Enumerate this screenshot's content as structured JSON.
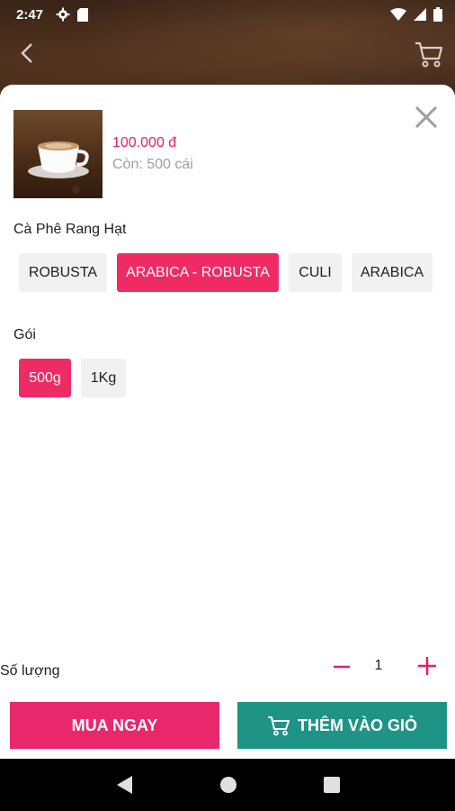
{
  "status_bar": {
    "time": "2:47"
  },
  "product": {
    "price": "100.000 đ",
    "stock": "Còn: 500 cái"
  },
  "variant_groups": [
    {
      "title": "Cà Phê Rang Hạt",
      "options": [
        "ROBUSTA",
        "ARABICA - ROBUSTA",
        "CULI",
        "ARABICA"
      ],
      "selected": 1
    },
    {
      "title": "Gói",
      "options": [
        "500g",
        "1Kg"
      ],
      "selected": 0
    }
  ],
  "quantity": {
    "label": "Số lượng",
    "value": "1"
  },
  "actions": {
    "buy_now": "MUA NGAY",
    "add_to_cart": "THÊM VÀO GIỎ"
  },
  "colors": {
    "accent": "#ef2b66",
    "buy": "#e8286a",
    "cart": "#1f9486",
    "price": "#e91e63"
  },
  "icons": [
    "settings-icon",
    "sd-card-icon",
    "wifi-icon",
    "signal-icon",
    "battery-icon",
    "back-arrow-icon",
    "cart-icon",
    "close-icon",
    "minus-icon",
    "plus-icon",
    "nav-back-icon",
    "nav-home-icon",
    "nav-recents-icon"
  ]
}
